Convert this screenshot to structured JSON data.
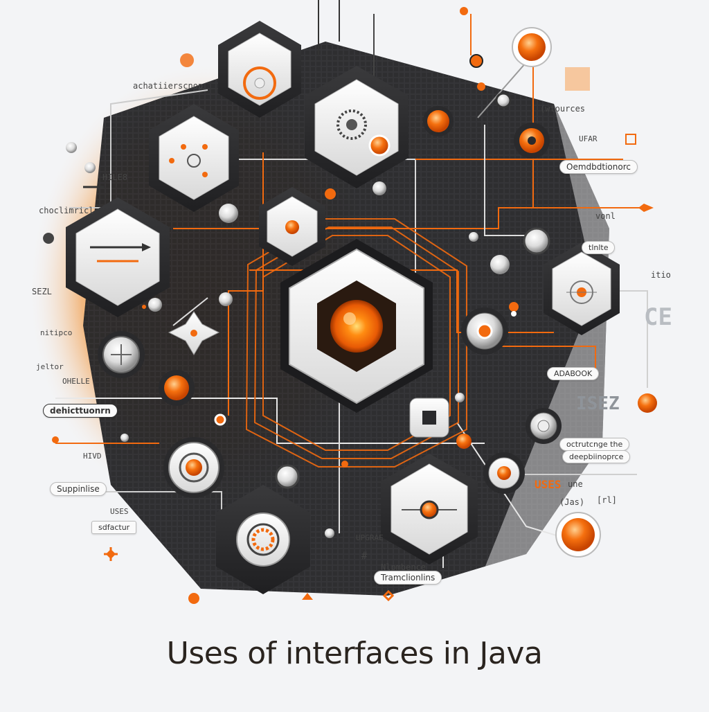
{
  "title": "Uses of interfaces in Java",
  "colors": {
    "accent": "#f26a0f",
    "dark": "#2b2b2d",
    "tile": "#f4f4f4",
    "background": "#f3f4f6"
  },
  "labels": {
    "top_left": "achatiierscnop",
    "hileb": "HILE8",
    "chocl": "choclimricl",
    "sez": "SEZL",
    "nitipco": "nitipco",
    "jeltor": "jeltor",
    "ohelle": "OHELLE",
    "hivd": "HIVD",
    "uses_small": "USES",
    "right_top": "(wtources",
    "right_ufar": "UFAR",
    "vonl": "vonl",
    "itio": "itio",
    "isez": "ISEZ",
    "ce": "CE",
    "uses_orange": "USES",
    "une": "une",
    "jas": "(Jas)",
    "hash": "#",
    "bracket": "[rl]",
    "upgrae": "UPGRAE",
    "nlpmbence": "Nlpmbence"
  },
  "pills": {
    "odmbdtionorc": "Oemdbdtionorc",
    "dehicttuonrn": "dehicttuonrn",
    "suppinlise": "Suppinlise",
    "sdfactur": "sdfactur",
    "adabook": "ADABOOK",
    "octrutcnge": "octrutcnge the",
    "deepbiinoprce": "deepbiinoprce",
    "transitions": "Tramclionlins",
    "tilnte": "tlnlte"
  },
  "icons": [
    "hexagon-ring-icon",
    "hexagon-gear-icon",
    "hexagon-dots-icon",
    "hexagon-slider-icon",
    "hexagon-dot-icon",
    "hexagon-core-icon",
    "hexagon-target-icon",
    "circle-knob-icon",
    "star-node-icon",
    "circle-target-icon",
    "square-node-icon",
    "hexagon-connector-icon",
    "circle-ring-icon",
    "circle-gear-icon",
    "orange-orb-icon"
  ]
}
